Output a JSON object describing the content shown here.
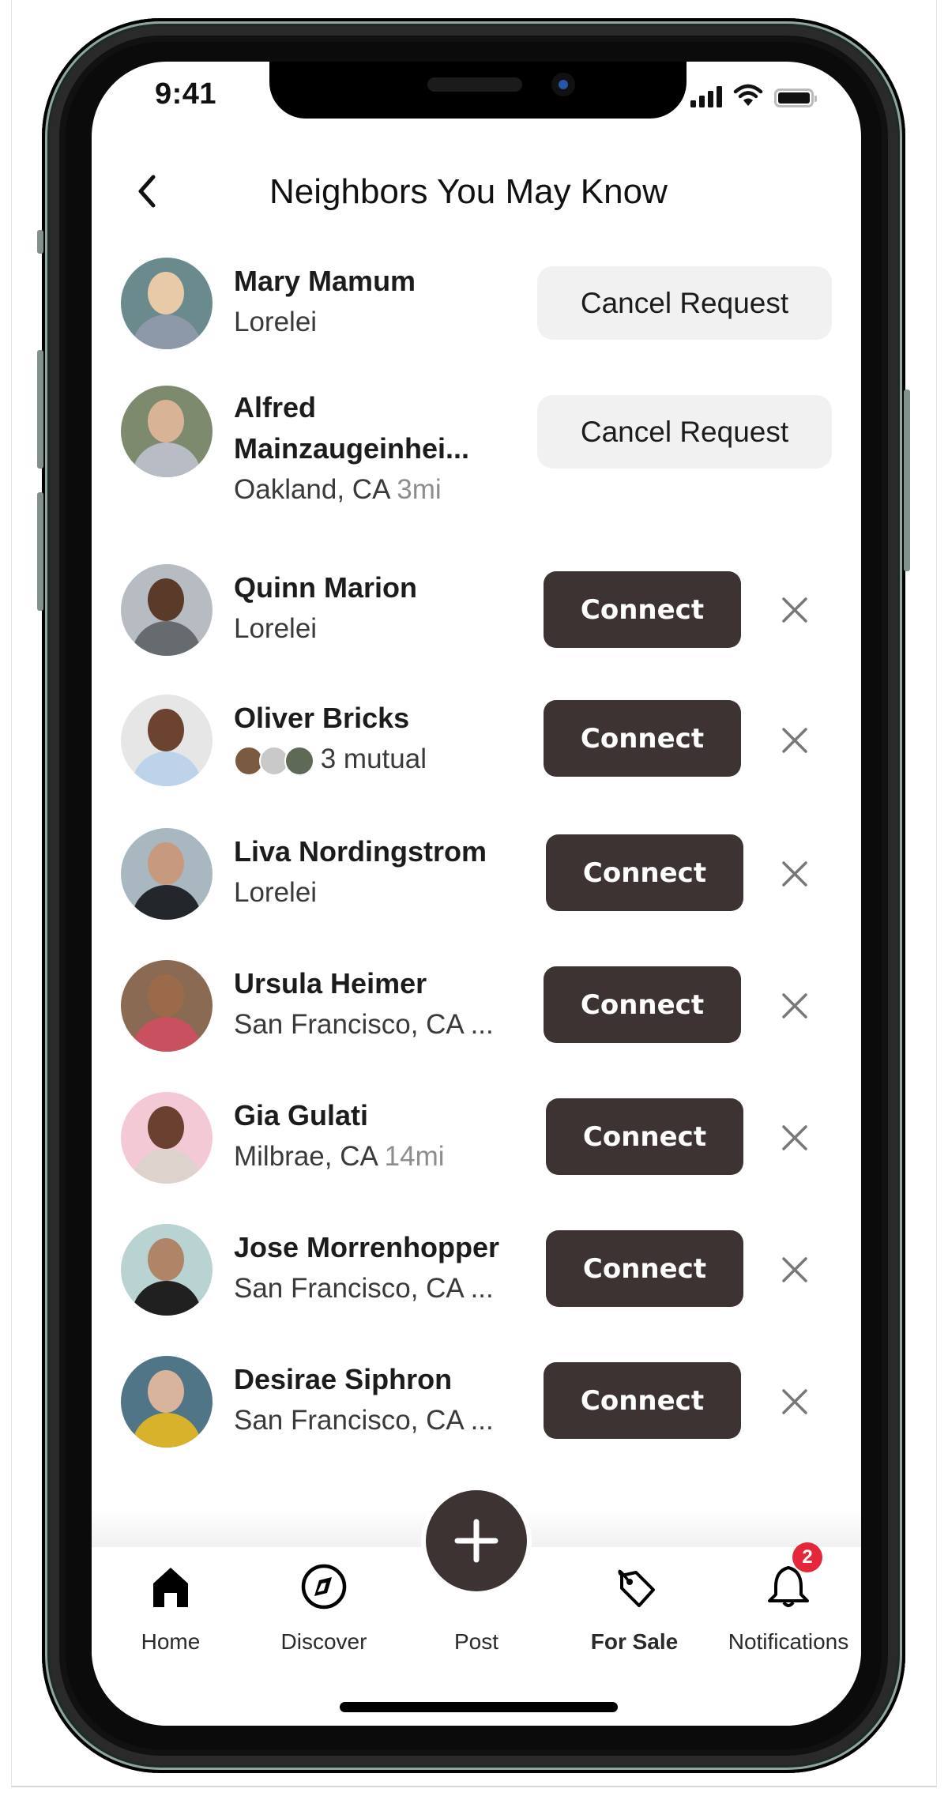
{
  "status_bar": {
    "time": "9:41",
    "icons": [
      "cellular-signal-icon",
      "wifi-icon",
      "battery-icon"
    ]
  },
  "header": {
    "back_icon": "chevron-left-icon",
    "title": "Neighbors You May Know"
  },
  "neighbors": [
    {
      "name": "Mary Mamum",
      "name_line2": "",
      "location": "Lorelei",
      "distance": "",
      "action": "Cancel Request",
      "dismissable": false,
      "avatar_colors": {
        "bg": "#6b8a8e",
        "head": "#e8c9a8",
        "body": "#8d98a8"
      }
    },
    {
      "name": "Alfred",
      "name_line2": "Mainzaugeinhei...",
      "location": "Oakland, CA",
      "distance": "3mi",
      "action": "Cancel Request",
      "dismissable": false,
      "avatar_colors": {
        "bg": "#7d8a6e",
        "head": "#d9b396",
        "body": "#b8bcc4"
      }
    },
    {
      "name": "Quinn Marion",
      "name_line2": "",
      "location": "Lorelei",
      "distance": "",
      "action": "Connect",
      "dismissable": true,
      "avatar_colors": {
        "bg": "#b7bcc2",
        "head": "#5a3b2a",
        "body": "#666b70"
      }
    },
    {
      "name": "Oliver Bricks",
      "name_line2": "",
      "location": "",
      "mutual": "3 mutual",
      "distance": "",
      "action": "Connect",
      "dismissable": true,
      "avatar_colors": {
        "bg": "#e6e6e6",
        "head": "#6b4330",
        "body": "#bcd3ea"
      }
    },
    {
      "name": "Liva Nordingstrom",
      "name_line2": "",
      "location": "Lorelei",
      "distance": "",
      "action": "Connect",
      "dismissable": true,
      "avatar_colors": {
        "bg": "#a9b7c0",
        "head": "#c79a80",
        "body": "#23262b"
      }
    },
    {
      "name": "Ursula Heimer",
      "name_line2": "",
      "location": "San Francisco, CA ...",
      "distance": "",
      "action": "Connect",
      "dismissable": true,
      "avatar_colors": {
        "bg": "#8a6a52",
        "head": "#9a6a4a",
        "body": "#c9505e"
      }
    },
    {
      "name": "Gia Gulati",
      "name_line2": "",
      "location": "Milbrae, CA",
      "distance": "14mi",
      "action": "Connect",
      "dismissable": true,
      "avatar_colors": {
        "bg": "#f2c9d4",
        "head": "#6a4030",
        "body": "#ddd3cc"
      }
    },
    {
      "name": "Jose Morrenhopper",
      "name_line2": "",
      "location": "San Francisco, CA ...",
      "distance": "",
      "action": "Connect",
      "dismissable": true,
      "avatar_colors": {
        "bg": "#b9d2d2",
        "head": "#b08466",
        "body": "#202020"
      }
    },
    {
      "name": "Desirae Siphron",
      "name_line2": "",
      "location": "San Francisco, CA ...",
      "distance": "",
      "action": "Connect",
      "dismissable": true,
      "avatar_colors": {
        "bg": "#4f7587",
        "head": "#d8b49c",
        "body": "#d7b22a"
      }
    }
  ],
  "mutual_avatar_colors": [
    "#7a5a40",
    "#c9c9c9",
    "#5e6a55"
  ],
  "bottom_nav": {
    "items": [
      {
        "label": "Home",
        "icon": "home-icon",
        "bold": false
      },
      {
        "label": "Discover",
        "icon": "compass-icon",
        "bold": false
      },
      {
        "label": "Post",
        "icon": "plus-icon",
        "bold": false
      },
      {
        "label": "For Sale",
        "icon": "price-tag-icon",
        "bold": true
      },
      {
        "label": "Notifications",
        "icon": "bell-icon",
        "bold": false,
        "badge": "2"
      }
    ]
  },
  "colors": {
    "primary_button": "#3d3333",
    "secondary_button": "#f1f1f1",
    "badge": "#e4283a",
    "muted_text": "#8d8d8d"
  }
}
